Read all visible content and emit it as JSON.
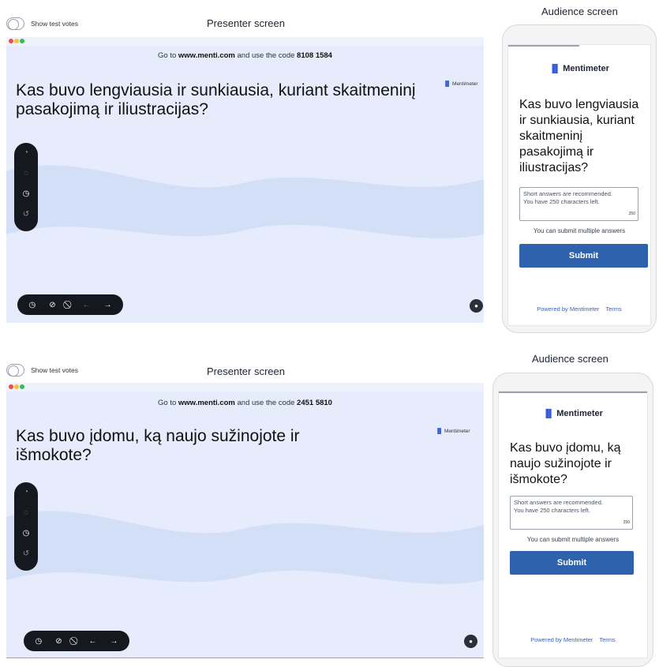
{
  "labels": {
    "show_test_votes": "Show test votes",
    "presenter_screen": "Presenter screen",
    "audience_screen": "Audience screen",
    "go_to_prefix": "Go to ",
    "menti_url": "www.menti.com",
    "code_middle": " and use the code ",
    "brand": "Mentimeter",
    "answer_hint_line1": "Short answers are recommended.",
    "answer_hint_line2": "You have 250 characters left.",
    "char_count": "250",
    "multi_note": "You can submit multiple answers",
    "submit": "Submit",
    "powered_by": "Powered by Mentimeter",
    "terms": "Terms"
  },
  "slides": [
    {
      "code": "8108 1584",
      "presenter_question": "Kas buvo lengviausia ir sunkiausia, kuriant skaitmeninį pasakojimą ir iliustracijas?",
      "audience_question": "Kas buvo lengviausia ir sunkiausia, kuriant skaitmeninį pasakojimą ir iliustracijas?"
    },
    {
      "code": "2451 5810",
      "presenter_question": "Kas buvo įdomu, ką naujo sužinojote ir išmokote?",
      "audience_question": "Kas buvo įdomu, ką naujo sužinojote ir išmokote?"
    }
  ],
  "icons": {
    "side_toolbar": [
      "reactions-icon",
      "q-and-a-icon",
      "timer-icon",
      "history-icon"
    ],
    "bottom_toolbar": [
      "timer-icon",
      "hide-results-icon",
      "block-votes-icon",
      "arrow-left-icon",
      "arrow-right-icon"
    ],
    "corner": "user-icon",
    "brand_logo": "bar-chart-icon"
  },
  "colors": {
    "slide_background": "#e6ecfb",
    "wave": "#d3dff6",
    "toolbar": "#15181f",
    "submit_button": "#2e62ad",
    "link": "#3a63bf"
  }
}
